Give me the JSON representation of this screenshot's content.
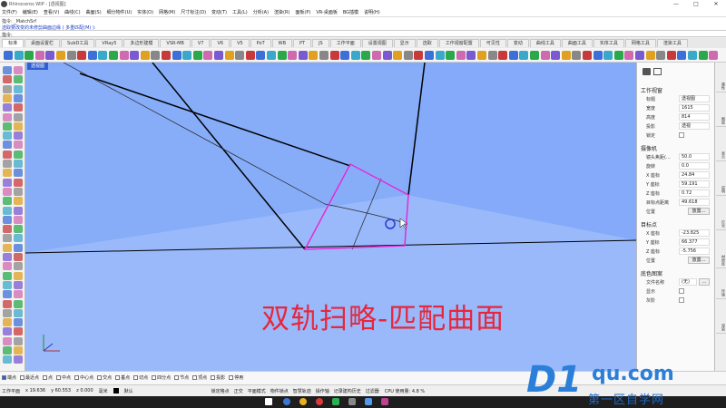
{
  "window": {
    "title": "Rhinoceros WIP - [透视图]",
    "controls": [
      "—",
      "□",
      "✕"
    ]
  },
  "menu": [
    "文件(F)",
    "编辑(E)",
    "查看(V)",
    "曲线(C)",
    "曲面(S)",
    "细分物件(U)",
    "实体(O)",
    "网格(M)",
    "尺寸标注(D)",
    "变动(T)",
    "工具(L)",
    "分析(A)",
    "渲染(R)",
    "面板(P)",
    "VR-桌面板",
    "BG插模",
    "说明(H)"
  ],
  "command_history": {
    "line1": "指令: _MatchSrf",
    "line2": "选取要改变的未修剪曲面边缘 ( 多重匹配(M) ):"
  },
  "command_prompt": "指令:",
  "tabs": [
    "标准",
    "桌面设置栏",
    "SubD工具",
    "VRay5",
    "多边形建模",
    "VSR-MB",
    "V7",
    "V6",
    "V5",
    "PoT",
    "WB",
    "PT",
    "JS",
    "工作平面",
    "设置视图",
    "显示",
    "选取",
    "工作视窗配置",
    "可见性",
    "变动",
    "曲线工具",
    "曲面工具",
    "实体工具",
    "网格工具",
    "渲染工具"
  ],
  "viewport": {
    "label": "透视图",
    "caption": "双轨扫略-匹配曲面",
    "colors": {
      "background": "#84aaf9",
      "surface": "#8fb2fb",
      "floor": "#99b9fb",
      "highlight": "#e52bd6",
      "edge": "#000000"
    }
  },
  "properties": {
    "section_viewport": "工作视窗",
    "title_label": "标题",
    "title_value": "透视图",
    "width_label": "宽度",
    "width_value": "1615",
    "height_label": "高度",
    "height_value": "814",
    "projection_label": "投影",
    "projection_value": "透视",
    "locked_label": "锁定",
    "section_camera": "摄像机",
    "lens_label": "镜头焦距(...",
    "lens_value": "50.0",
    "rotation_label": "旋转",
    "rotation_value": "0.0",
    "cx_label": "X 座标",
    "cx_value": "24.84",
    "cy_label": "Y 座标",
    "cy_value": "59.191",
    "cz_label": "Z 座标",
    "cz_value": "0.72",
    "dist_label": "目标点距离",
    "dist_value": "49.618",
    "cpos_label": "位置",
    "cpos_button": "放置...",
    "section_target": "目标点",
    "tx_label": "X 座标",
    "tx_value": "-23.825",
    "ty_label": "Y 座标",
    "ty_value": "66.377",
    "tz_label": "Z 座标",
    "tz_value": "-5.756",
    "tpos_label": "位置",
    "tpos_button": "放置...",
    "section_wallpaper": "底色图案",
    "file_label": "文件名称",
    "file_value": "(无)",
    "show_label": "显示",
    "gray_label": "灰阶"
  },
  "side_tabs": [
    "属性",
    "图层",
    "显示",
    "说明",
    "灯光",
    "材质库",
    "环境",
    "渲染"
  ],
  "osnap": [
    {
      "label": "端点",
      "on": true
    },
    {
      "label": "最近点",
      "on": false
    },
    {
      "label": "点",
      "on": false
    },
    {
      "label": "中点",
      "on": false
    },
    {
      "label": "中心点",
      "on": false
    },
    {
      "label": "交点",
      "on": false
    },
    {
      "label": "垂点",
      "on": false
    },
    {
      "label": "切点",
      "on": false
    },
    {
      "label": "四分点",
      "on": false
    },
    {
      "label": "节点",
      "on": false
    },
    {
      "label": "顶点",
      "on": false
    },
    {
      "label": "投影",
      "on": false
    },
    {
      "label": "停用",
      "on": false
    }
  ],
  "status": {
    "cplane": "工作平面",
    "x": "x 19.636",
    "y": "y 60.553",
    "z": "z 0.000",
    "unit": "毫米",
    "layer": "默认",
    "buttons": [
      "锁定格点",
      "正交",
      "平面模式",
      "物件锁点",
      "智慧轨迹",
      "操作轴",
      "记录建构历史",
      "过滤器"
    ],
    "cpu": "CPU 使用量: 4.8 %"
  },
  "watermark": {
    "brand": "D1",
    "domain": "qu.com",
    "sub": "第一区自学网"
  }
}
